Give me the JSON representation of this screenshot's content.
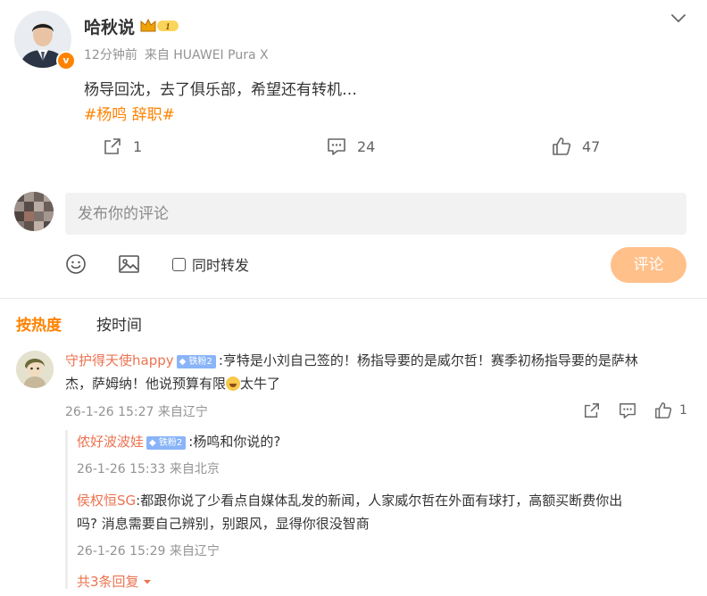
{
  "post": {
    "author": "哈秋说",
    "vip_level": "1",
    "time": "12分钟前",
    "source": "来自 HUAWEI Pura X",
    "text": "杨导回沈，去了俱乐部，希望还有转机…",
    "hashtag": "#杨鸣 辞职#",
    "repost_count": "1",
    "comment_count": "24",
    "like_count": "47",
    "icons": [
      "chevron-down-icon",
      "verified-v-icon",
      "crown-icon",
      "repost-icon",
      "comment-icon",
      "like-icon"
    ]
  },
  "composer": {
    "placeholder": "发布你的评论",
    "repost_label": "同时转发",
    "submit_label": "评论",
    "icons": [
      "emoji-icon",
      "image-icon",
      "checkbox-icon"
    ]
  },
  "sort_tabs": {
    "hot": "按热度",
    "time": "按时间"
  },
  "comment": {
    "user": "守护得天使happy",
    "badge": "铁粉2",
    "text_part1": ":亨特是小刘自己签的！杨指导要的是威尔哲！赛季初杨指导要的是萨林",
    "text_part2": "杰，萨姆纳！他说预算有限",
    "text_part3": "太牛了",
    "time": "26-1-26 15:27 来自辽宁",
    "like_count": "1",
    "replies": [
      {
        "user": "侬好波波娃",
        "badge": "铁粉2",
        "text": ":杨鸣和你说的?",
        "time": "26-1-26 15:33 来自北京"
      },
      {
        "user": "侯权恒SG",
        "text_part1": ":都跟你说了少看点自媒体乱发的新闻，人家威尔哲在外面有球打，高额买断费你出",
        "text_part2": "吗? 消息需要自己辨别，别跟风，显得你很没智商",
        "time": "26-1-26 15:29 来自辽宁"
      }
    ],
    "more_replies": "共3条回复"
  },
  "colors": {
    "accent": "#ff8200",
    "username": "#eb7350",
    "muted": "#939393",
    "submit_disabled": "#ffc08a",
    "fan_badge": "#8ab4f8"
  }
}
